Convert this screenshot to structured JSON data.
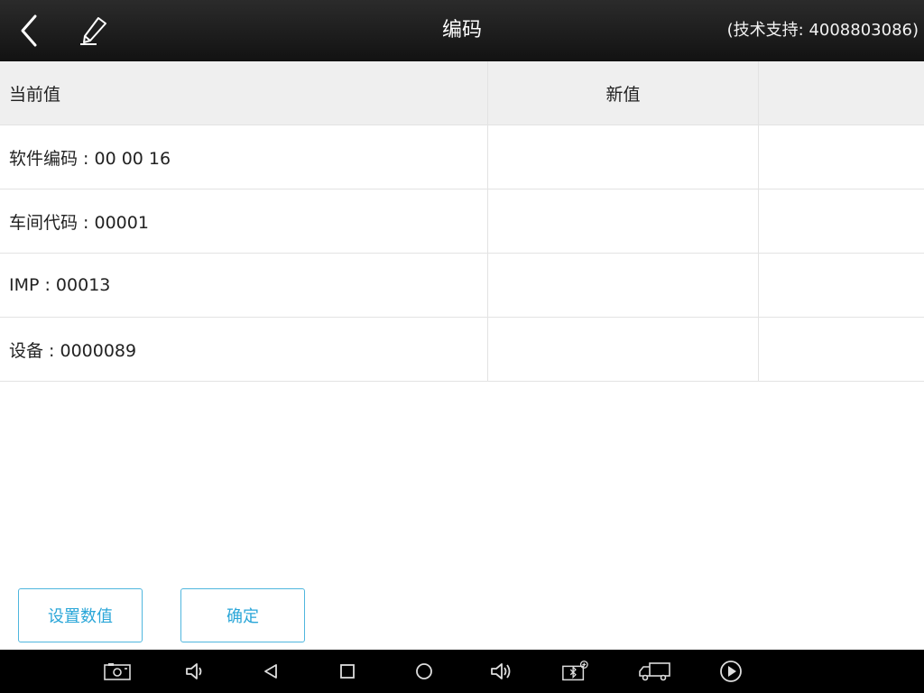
{
  "topbar": {
    "title": "编码",
    "support": "(技术支持: 4008803086)",
    "icons": [
      "back-icon",
      "edit-pencil-icon"
    ]
  },
  "table": {
    "headers": [
      "当前值",
      "新值",
      ""
    ],
    "rows": [
      {
        "current": "软件编码 : 00 00 16",
        "new": "",
        "extra": ""
      },
      {
        "current": "车间代码 : 00001",
        "new": "",
        "extra": ""
      },
      {
        "current": "IMP : 00013",
        "new": "",
        "extra": ""
      },
      {
        "current": "设备 : 0000089",
        "new": "",
        "extra": ""
      }
    ]
  },
  "buttons": {
    "set_value": "设置数值",
    "confirm": "确定"
  },
  "navbar": {
    "icons": [
      "screenshot-icon",
      "volume-down-icon",
      "back-triangle-icon",
      "recent-apps-icon",
      "home-icon",
      "volume-up-icon",
      "vci-bluetooth-icon",
      "truck-icon",
      "play-icon"
    ]
  },
  "colors": {
    "accent": "#2aa6d8",
    "topbar": "#1c1c1c",
    "header_row": "#efefef"
  }
}
